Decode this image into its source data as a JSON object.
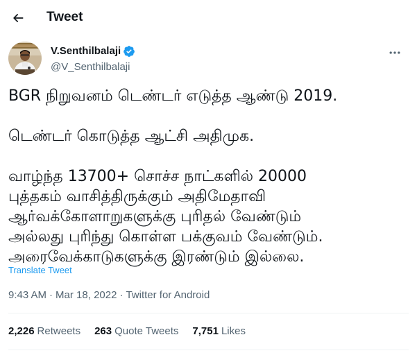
{
  "header": {
    "title": "Tweet",
    "back_icon": "arrow-left-icon"
  },
  "author": {
    "name": "V.Senthilbalaji",
    "handle": "@V_Senthilbalaji",
    "verified": true,
    "verified_color": "#1d9bf0"
  },
  "tweet": {
    "lines": [
      "BGR நிறுவனம் டெண்டர் எடுத்த ஆண்டு 2019.",
      "",
      "டெண்டர் கொடுத்த ஆட்சி அதிமுக.",
      "",
      "வாழ்ந்த 13700+  சொச்ச நாட்களில் 20000",
      "புத்தகம் வாசித்திருக்கும் அதிமேதாவி",
      "ஆர்வக்கோளாறுகளுக்கு புரிதல் வேண்டும்",
      "அல்லது புரிந்து கொள்ள பக்குவம் வேண்டும்.",
      "அரைவேக்காடுகளுக்கு இரண்டும் இல்லை."
    ],
    "translate_label": "Translate Tweet"
  },
  "meta": {
    "time": "9:43 AM",
    "separator": "·",
    "date": "Mar 18, 2022",
    "source": "Twitter for Android"
  },
  "stats": {
    "retweets_count": "2,226",
    "retweets_label": "Retweets",
    "quotes_count": "263",
    "quotes_label": "Quote Tweets",
    "likes_count": "7,751",
    "likes_label": "Likes"
  },
  "colors": {
    "text": "#0f1419",
    "secondary": "#536471",
    "link": "#1d9bf0",
    "divider": "#eff3f4"
  }
}
